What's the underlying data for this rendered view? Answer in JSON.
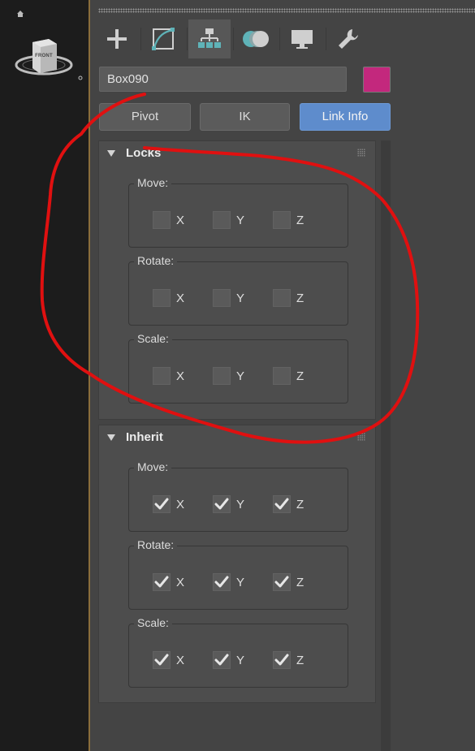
{
  "name_field": {
    "value": "Box090"
  },
  "color_swatch": {
    "color": "#c3287d"
  },
  "tabs": [
    {
      "icon": "create-plus-icon",
      "active": false
    },
    {
      "icon": "modify-curve-icon",
      "active": false
    },
    {
      "icon": "hierarchy-icon",
      "active": true
    },
    {
      "icon": "motion-circles-icon",
      "active": false
    },
    {
      "icon": "display-monitor-icon",
      "active": false
    },
    {
      "icon": "utilities-wrench-icon",
      "active": false
    }
  ],
  "buttons": {
    "pivot": "Pivot",
    "ik": "IK",
    "link_info": "Link Info"
  },
  "viewcube": {
    "label": "FRONT"
  },
  "locks": {
    "title": "Locks",
    "move": {
      "label": "Move:",
      "x": "X",
      "y": "Y",
      "z": "Z",
      "checked": [
        false,
        false,
        false
      ]
    },
    "rotate": {
      "label": "Rotate:",
      "x": "X",
      "y": "Y",
      "z": "Z",
      "checked": [
        false,
        false,
        false
      ]
    },
    "scale": {
      "label": "Scale:",
      "x": "X",
      "y": "Y",
      "z": "Z",
      "checked": [
        false,
        false,
        false
      ]
    }
  },
  "inherit": {
    "title": "Inherit",
    "move": {
      "label": "Move:",
      "x": "X",
      "y": "Y",
      "z": "Z",
      "checked": [
        true,
        true,
        true
      ]
    },
    "rotate": {
      "label": "Rotate:",
      "x": "X",
      "y": "Y",
      "z": "Z",
      "checked": [
        true,
        true,
        true
      ]
    },
    "scale": {
      "label": "Scale:",
      "x": "X",
      "y": "Y",
      "z": "Z",
      "checked": [
        true,
        true,
        true
      ]
    }
  },
  "colors": {
    "accent_button": "#5e8ccc",
    "annotation_red": "#e01010",
    "viewport_border": "#8a6d3b"
  }
}
